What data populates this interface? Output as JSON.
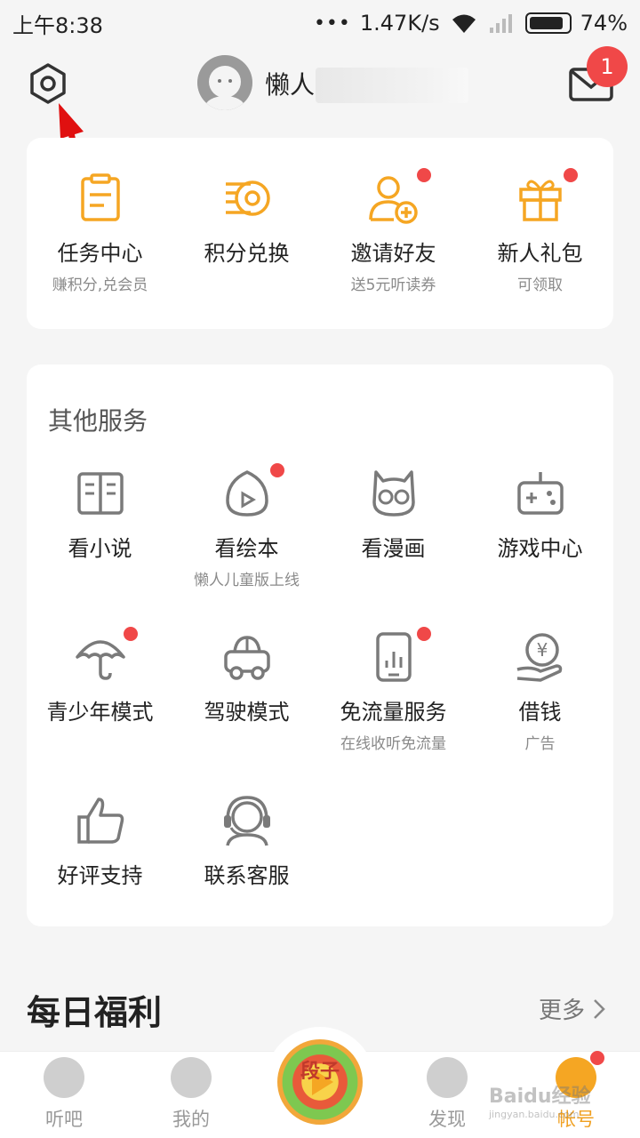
{
  "status_bar": {
    "time": "上午8:38",
    "dots": "•••",
    "speed": "1.47K/s",
    "battery": "74%"
  },
  "header": {
    "username": "懒人",
    "mail_badge": "1"
  },
  "top_entries": [
    {
      "label": "任务中心",
      "sub": "赚积分,兑会员",
      "icon": "task-clipboard-icon",
      "dot": false
    },
    {
      "label": "积分兑换",
      "sub": "",
      "icon": "coin-exchange-icon",
      "dot": false
    },
    {
      "label": "邀请好友",
      "sub": "送5元听读券",
      "icon": "add-user-icon",
      "dot": true
    },
    {
      "label": "新人礼包",
      "sub": "可领取",
      "icon": "gift-icon",
      "dot": true
    }
  ],
  "services": {
    "title": "其他服务",
    "items": [
      {
        "label": "看小说",
        "sub": "",
        "icon": "book-icon",
        "dot": false
      },
      {
        "label": "看绘本",
        "sub": "懒人儿童版上线",
        "icon": "picture-book-icon",
        "dot": true
      },
      {
        "label": "看漫画",
        "sub": "",
        "icon": "owl-icon",
        "dot": false
      },
      {
        "label": "游戏中心",
        "sub": "",
        "icon": "gamepad-icon",
        "dot": false
      },
      {
        "label": "青少年模式",
        "sub": "",
        "icon": "umbrella-icon",
        "dot": true
      },
      {
        "label": "驾驶模式",
        "sub": "",
        "icon": "car-icon",
        "dot": false
      },
      {
        "label": "免流量服务",
        "sub": "在线收听免流量",
        "icon": "phone-data-icon",
        "dot": true
      },
      {
        "label": "借钱",
        "sub": "广告",
        "icon": "loan-icon",
        "dot": false
      },
      {
        "label": "好评支持",
        "sub": "",
        "icon": "thumbs-up-icon",
        "dot": false
      },
      {
        "label": "联系客服",
        "sub": "",
        "icon": "headset-agent-icon",
        "dot": false
      }
    ]
  },
  "daily": {
    "title": "每日福利",
    "more": "更多"
  },
  "tabbar": {
    "tabs": [
      {
        "label": "听吧"
      },
      {
        "label": "我的"
      },
      {
        "label": "发现"
      },
      {
        "label": "帐号"
      }
    ],
    "center_text": "段子"
  },
  "watermark": {
    "text": "Baidu经验",
    "sub": "jingyan.baidu.com"
  },
  "colors": {
    "accent": "#f5a623",
    "badge": "#f04848",
    "icon_gray": "#7a7a7a"
  }
}
